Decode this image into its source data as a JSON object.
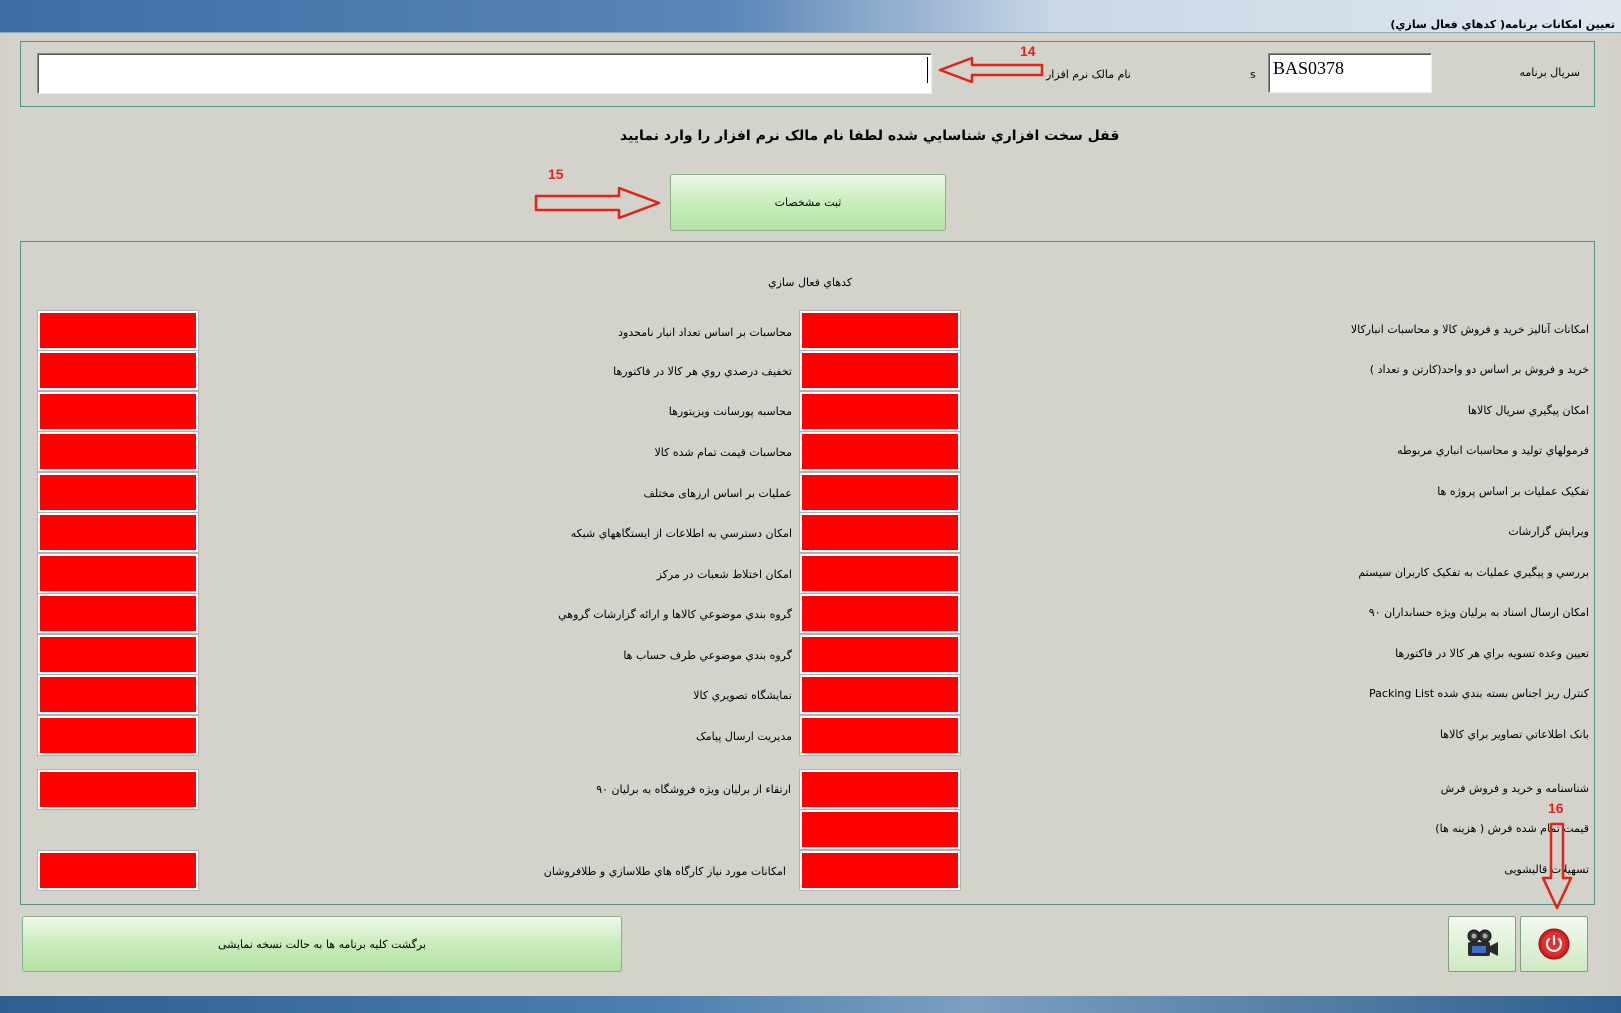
{
  "window": {
    "title": "تعیین امکانات برنامه( کدهاي فعال سازي)"
  },
  "header": {
    "serial_label": "سريال برنامه",
    "serial_value": "BAS0378",
    "s_label": "s",
    "owner_label": "نام مالک نرم افزار",
    "owner_value": ""
  },
  "message": "قفل سخت افزاري شناسايي شده لطفا نام مالک نرم افزار را وارد نماييد",
  "register_button": "ثبت مشخصات",
  "activation_title": "کدهاي فعال سازي",
  "right_features": [
    "امکانات آنالیز خرید و فروش کالا و محاسبات انبارکالا",
    "خرید و فروش بر اساس دو واحد(کارتن و تعداد )",
    "امکان پیگیري سريال کالاها",
    "فرمولهاي توليد و محاسبات انباري مربوطه",
    "تفکیک عملیات بر اساس پروژه ها",
    "ويرايش گزارشات",
    "بررسي و پيگيري عمليات به تفکيک کاربران سيستم",
    "امکان ارسال اسناد به برلیان ویژه حسابداران ۹۰",
    "تعيين وعده تسويه براي هر کالا در فاکتورها",
    "کنترل ريز اجناس بسته بندي شده Packing List",
    "بانک اطلاعاتي تصاوير براي کالاها",
    "شناسنامه و خرید و فروش فرش",
    "قیمت تمام شده فرش ( هزینه ها)",
    "تسهیلات قالیشویی"
  ],
  "left_features": [
    "محاسبات  بر اساس تعداد انبار نامحدود",
    "تخفيف درصدي روي هر کالا در فاکتورها",
    "محاسبه پورسانت ويزيتورها",
    "محاسبات قیمت تمام شده کالا",
    "عملیات بر اساس ارزهای مختلف",
    "امکان دسترسي به اطلاعات از ايستگاههاي شبکه",
    "امکان اختلاط شعبات در مرکز",
    "گروه بندي موضوعي کالاها و ارائه گزارشات گروهي",
    "گروه بندي موضوعي طرف حساب ها",
    "نمايشگاه تصويري کالا",
    "مديريت ارسال پيامک",
    "ارتقاء از برلیان ویژه فروشگاه به برلیان ۹۰",
    "امکانات مورد نياز کارگاه هاي طلاسازي و طلافروشان"
  ],
  "revert_button": "برگشت کلیه برنامه ها به حالت نسخه نمایشی",
  "annotations": [
    "14",
    "15",
    "16"
  ],
  "icons": {
    "camera": "video-camera-icon",
    "power": "power-icon"
  },
  "colors": {
    "activation_box": "#ff0000",
    "annotation": "#e0241b",
    "button_green": "#c9ecbc"
  }
}
